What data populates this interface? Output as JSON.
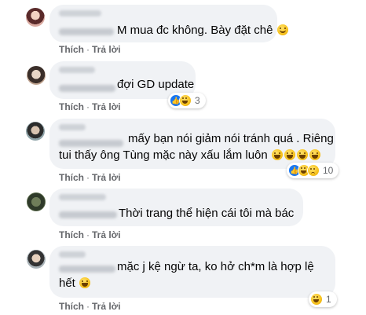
{
  "actions": {
    "like_label": "Thích",
    "reply_label": "Trả lời",
    "separator": "·"
  },
  "comments": [
    {
      "text": "M mua đc không. Bày đặt chê",
      "trailing_emoji": "smile-emoji",
      "reactions": null
    },
    {
      "text": "đợi GD update",
      "reactions": {
        "icons": [
          "like-icon",
          "haha-icon"
        ],
        "count": "3"
      }
    },
    {
      "text_line1": "mấy bạn nói giảm nói tránh quá . Riêng",
      "text_line2": "tui thấy ông Tùng mặc này xấu lắm luôn",
      "trailing_emoji": "laugh-emoji",
      "reactions": {
        "icons": [
          "like-icon",
          "haha-icon",
          "sad-icon"
        ],
        "count": "10"
      }
    },
    {
      "text": "Thời trang thể hiện cái tôi mà bác",
      "reactions": null
    },
    {
      "text_line1": "mặc j kệ ngừ ta, ko hở ch*m là hợp lệ",
      "text_line2": "hết",
      "trailing_emoji": "laugh-emoji",
      "reactions": {
        "icons": [
          "haha-icon"
        ],
        "count": "1"
      }
    }
  ],
  "colors": {
    "bubble": "#f0f2f5",
    "action_text": "#65676b",
    "like_blue": "#1877f2"
  }
}
